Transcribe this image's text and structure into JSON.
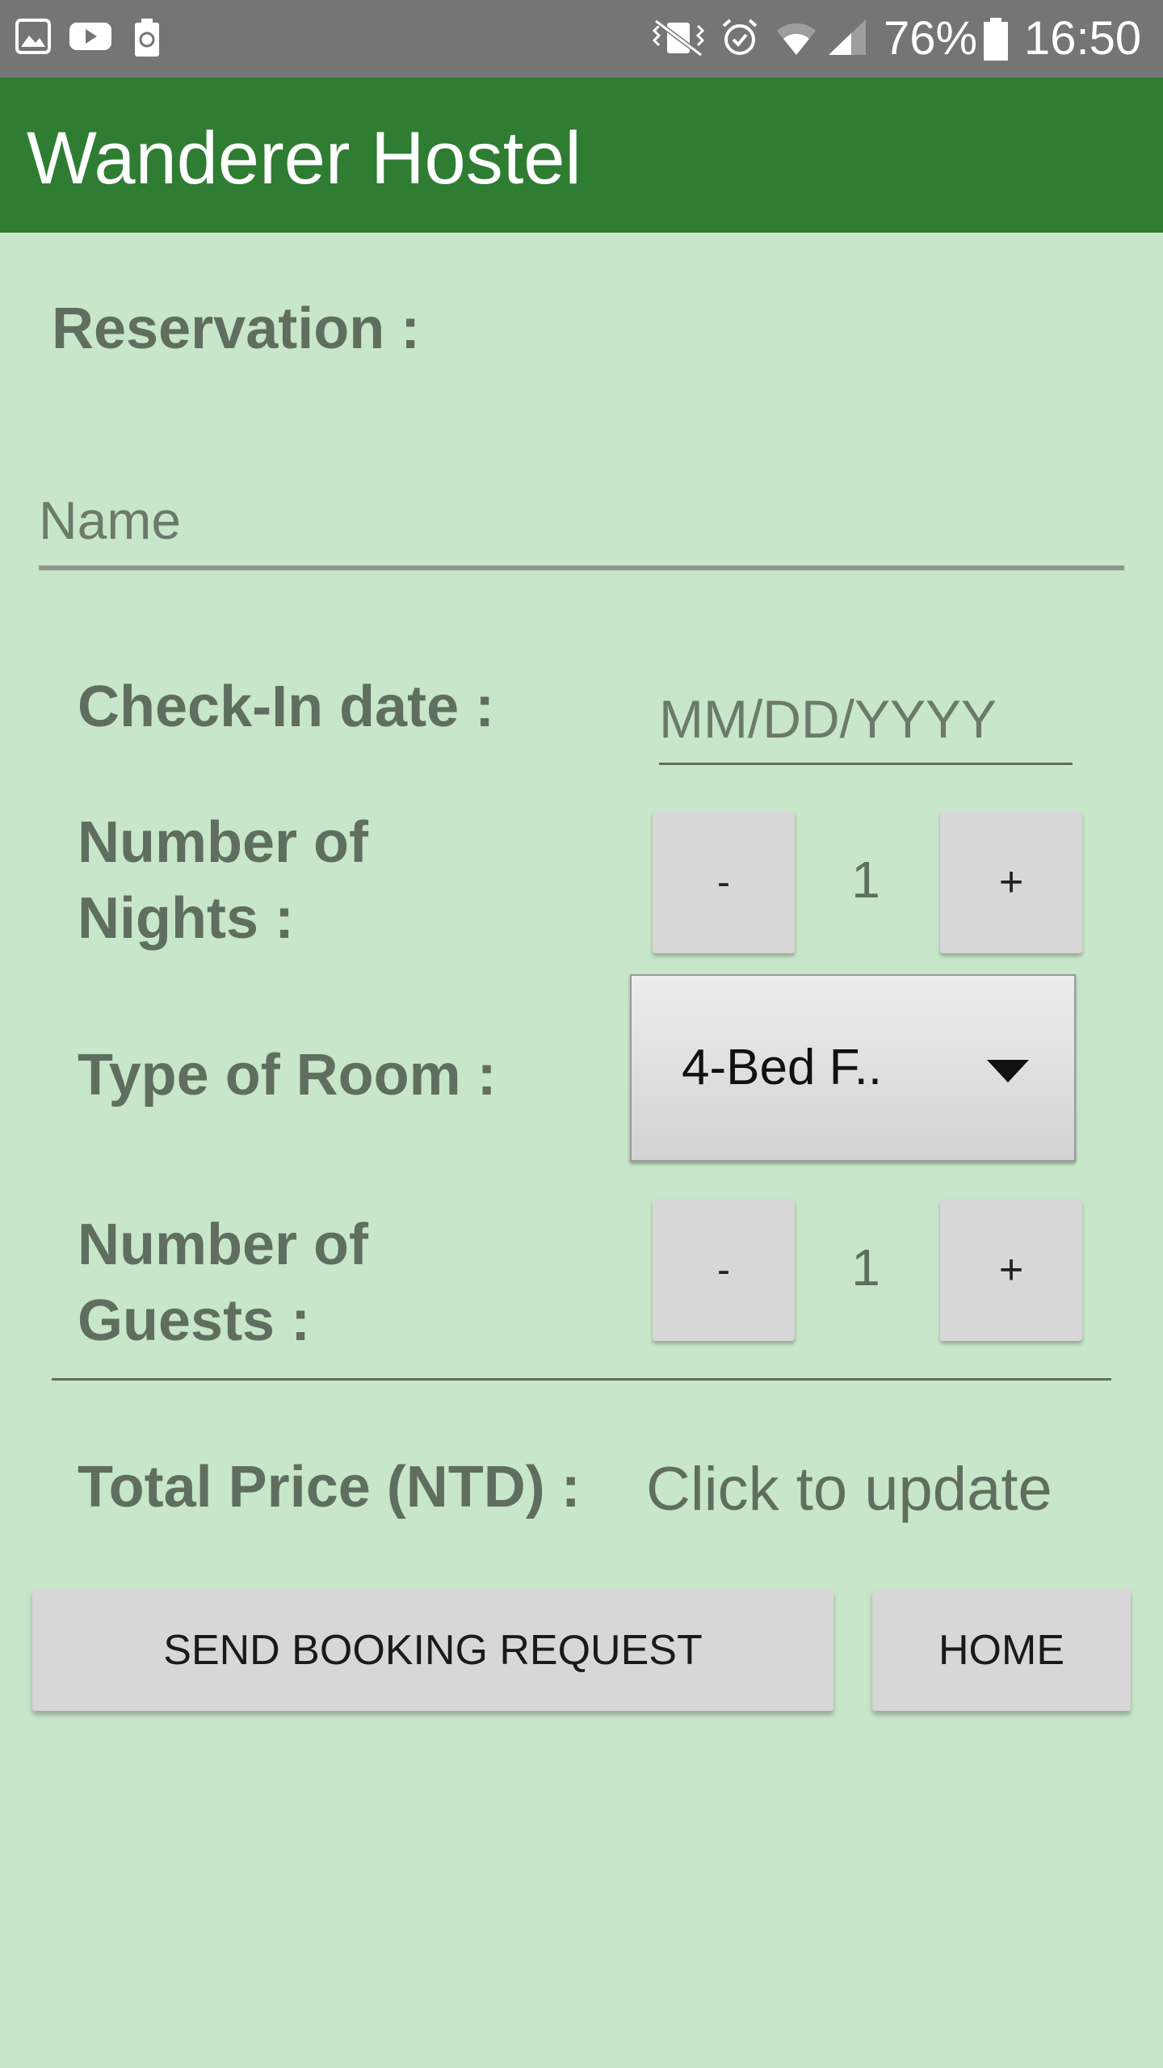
{
  "status_bar": {
    "battery": "76%",
    "time": "16:50",
    "icons": [
      "gallery-icon",
      "youtube-icon",
      "battery-saver-icon",
      "vibrate-icon",
      "alarm-icon",
      "wifi-icon",
      "signal-icon",
      "battery-icon"
    ]
  },
  "app_bar": {
    "title": "Wanderer Hostel"
  },
  "form": {
    "section_title": "Reservation :",
    "name_placeholder": "Name",
    "checkin_label": "Check-In date :",
    "checkin_placeholder": "MM/DD/YYYY",
    "nights_label_line1": "Number of",
    "nights_label_line2": "Nights :",
    "nights_value": "1",
    "room_label": "Type of Room :",
    "room_selected": "4-Bed F..",
    "guests_label_line1": "Number of",
    "guests_label_line2": "Guests :",
    "guests_value": "1",
    "minus_label": "-",
    "plus_label": "+",
    "price_label": "Total Price (NTD) :",
    "price_value": "Click to update"
  },
  "actions": {
    "send_label": "SEND BOOKING REQUEST",
    "home_label": "HOME"
  },
  "colors": {
    "background": "#c8e6c9",
    "app_bar": "#2e7d32",
    "status_bar": "#757575",
    "label_text": "#5f6e5f"
  }
}
